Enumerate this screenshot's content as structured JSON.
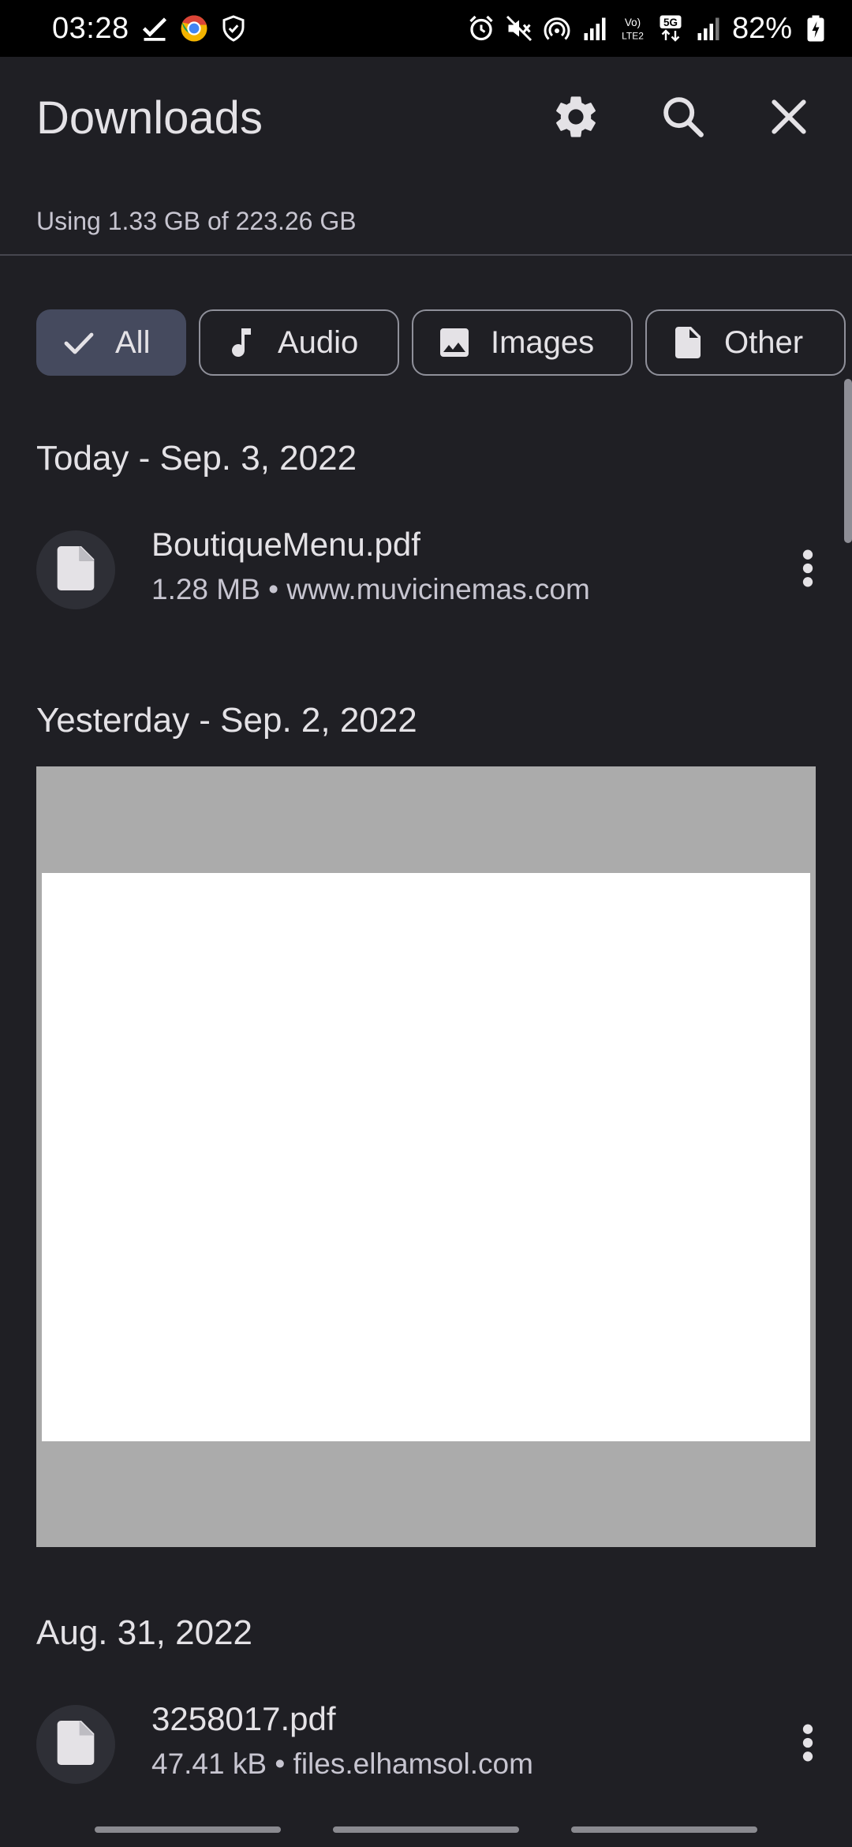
{
  "status_bar": {
    "time": "03:28",
    "battery": "82%",
    "left_icons": [
      "check-icon",
      "chrome-dev-icon",
      "shield-icon"
    ],
    "right_icons": [
      "alarm-icon",
      "mute-icon",
      "hotspot-icon",
      "signal-icon",
      "volte-icon",
      "5g-icon",
      "signal-icon",
      "battery-icon"
    ]
  },
  "header": {
    "title": "Downloads",
    "settings_icon": "gear-icon",
    "search_icon": "search-icon",
    "close_icon": "close-icon"
  },
  "storage": {
    "text": "Using 1.33 GB of 223.26 GB"
  },
  "filters": [
    {
      "label": "All",
      "icon": "check-icon",
      "selected": true
    },
    {
      "label": "Audio",
      "icon": "music-note-icon",
      "selected": false
    },
    {
      "label": "Images",
      "icon": "image-icon",
      "selected": false
    },
    {
      "label": "Other",
      "icon": "file-icon",
      "selected": false
    }
  ],
  "sections": [
    {
      "header": "Today - Sep. 3, 2022",
      "items": [
        {
          "name": "BoutiqueMenu.pdf",
          "meta": "1.28 MB • www.muvicinemas.com"
        }
      ]
    },
    {
      "header": "Yesterday - Sep. 2, 2022",
      "items": []
    },
    {
      "header": "Aug. 31, 2022",
      "items": [
        {
          "name": "3258017.pdf",
          "meta": "47.41 kB • files.elhamsol.com"
        }
      ]
    }
  ],
  "colors": {
    "background": "#1f1f24",
    "chip_selected": "#454a5e",
    "text_primary": "#e4e2e6",
    "text_secondary": "#c7c5d0"
  }
}
